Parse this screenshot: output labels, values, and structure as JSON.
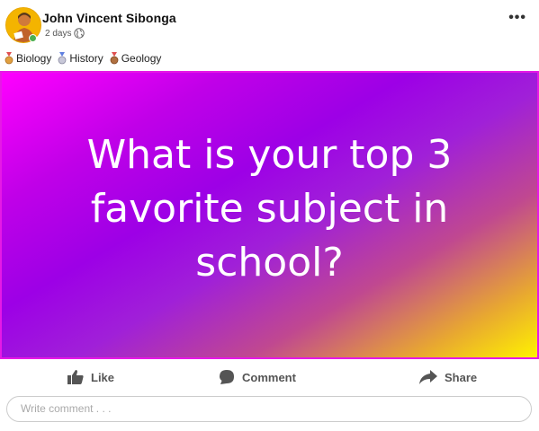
{
  "post": {
    "author": "John Vincent Sibonga",
    "time": "2 days",
    "tags": [
      "Biology",
      "History",
      "Geology"
    ],
    "banner_text": "What is your top 3 favorite subject in school?",
    "icons": {
      "more": "more-options-icon",
      "privacy": "globe-icon",
      "tag_badge": "medal-icon"
    }
  },
  "actions": {
    "like_label": "Like",
    "comment_label": "Comment",
    "share_label": "Share"
  },
  "comment_input": {
    "placeholder": "Write comment . . ."
  },
  "colors": {
    "banner_border": "#e619e6",
    "gradient_start": "#ff00ff",
    "gradient_mid": "#9d00e6",
    "gradient_end": "#fff200"
  }
}
